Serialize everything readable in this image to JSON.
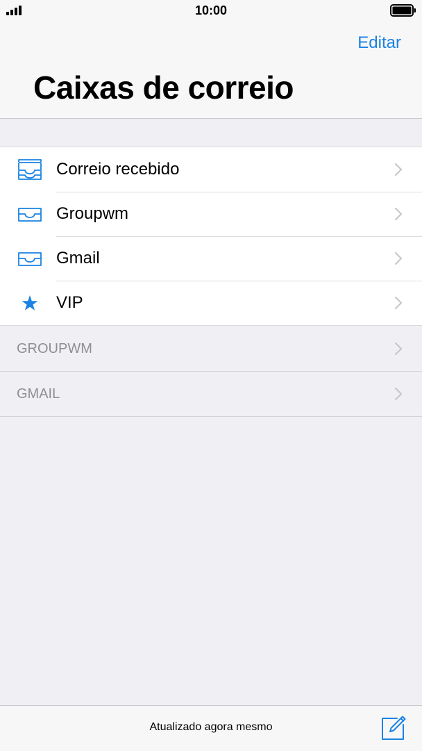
{
  "status_bar": {
    "time": "10:00",
    "signal_icon": "signal-bars-icon",
    "battery_icon": "battery-icon"
  },
  "nav": {
    "edit_label": "Editar",
    "title": "Caixas de correio"
  },
  "mailboxes": [
    {
      "label": "Correio recebido",
      "icon": "all-inboxes-icon"
    },
    {
      "label": "Groupwm",
      "icon": "inbox-tray-icon"
    },
    {
      "label": "Gmail",
      "icon": "inbox-tray-icon"
    },
    {
      "label": "VIP",
      "icon": "star-icon"
    }
  ],
  "accounts": [
    {
      "label": "GROUPWM"
    },
    {
      "label": "GMAIL"
    }
  ],
  "toolbar": {
    "status_text": "Atualizado agora mesmo",
    "compose_icon": "compose-icon"
  },
  "colors": {
    "accent": "#1a82e3",
    "background": "#efeff4",
    "secondary_text": "#8e8e93"
  }
}
